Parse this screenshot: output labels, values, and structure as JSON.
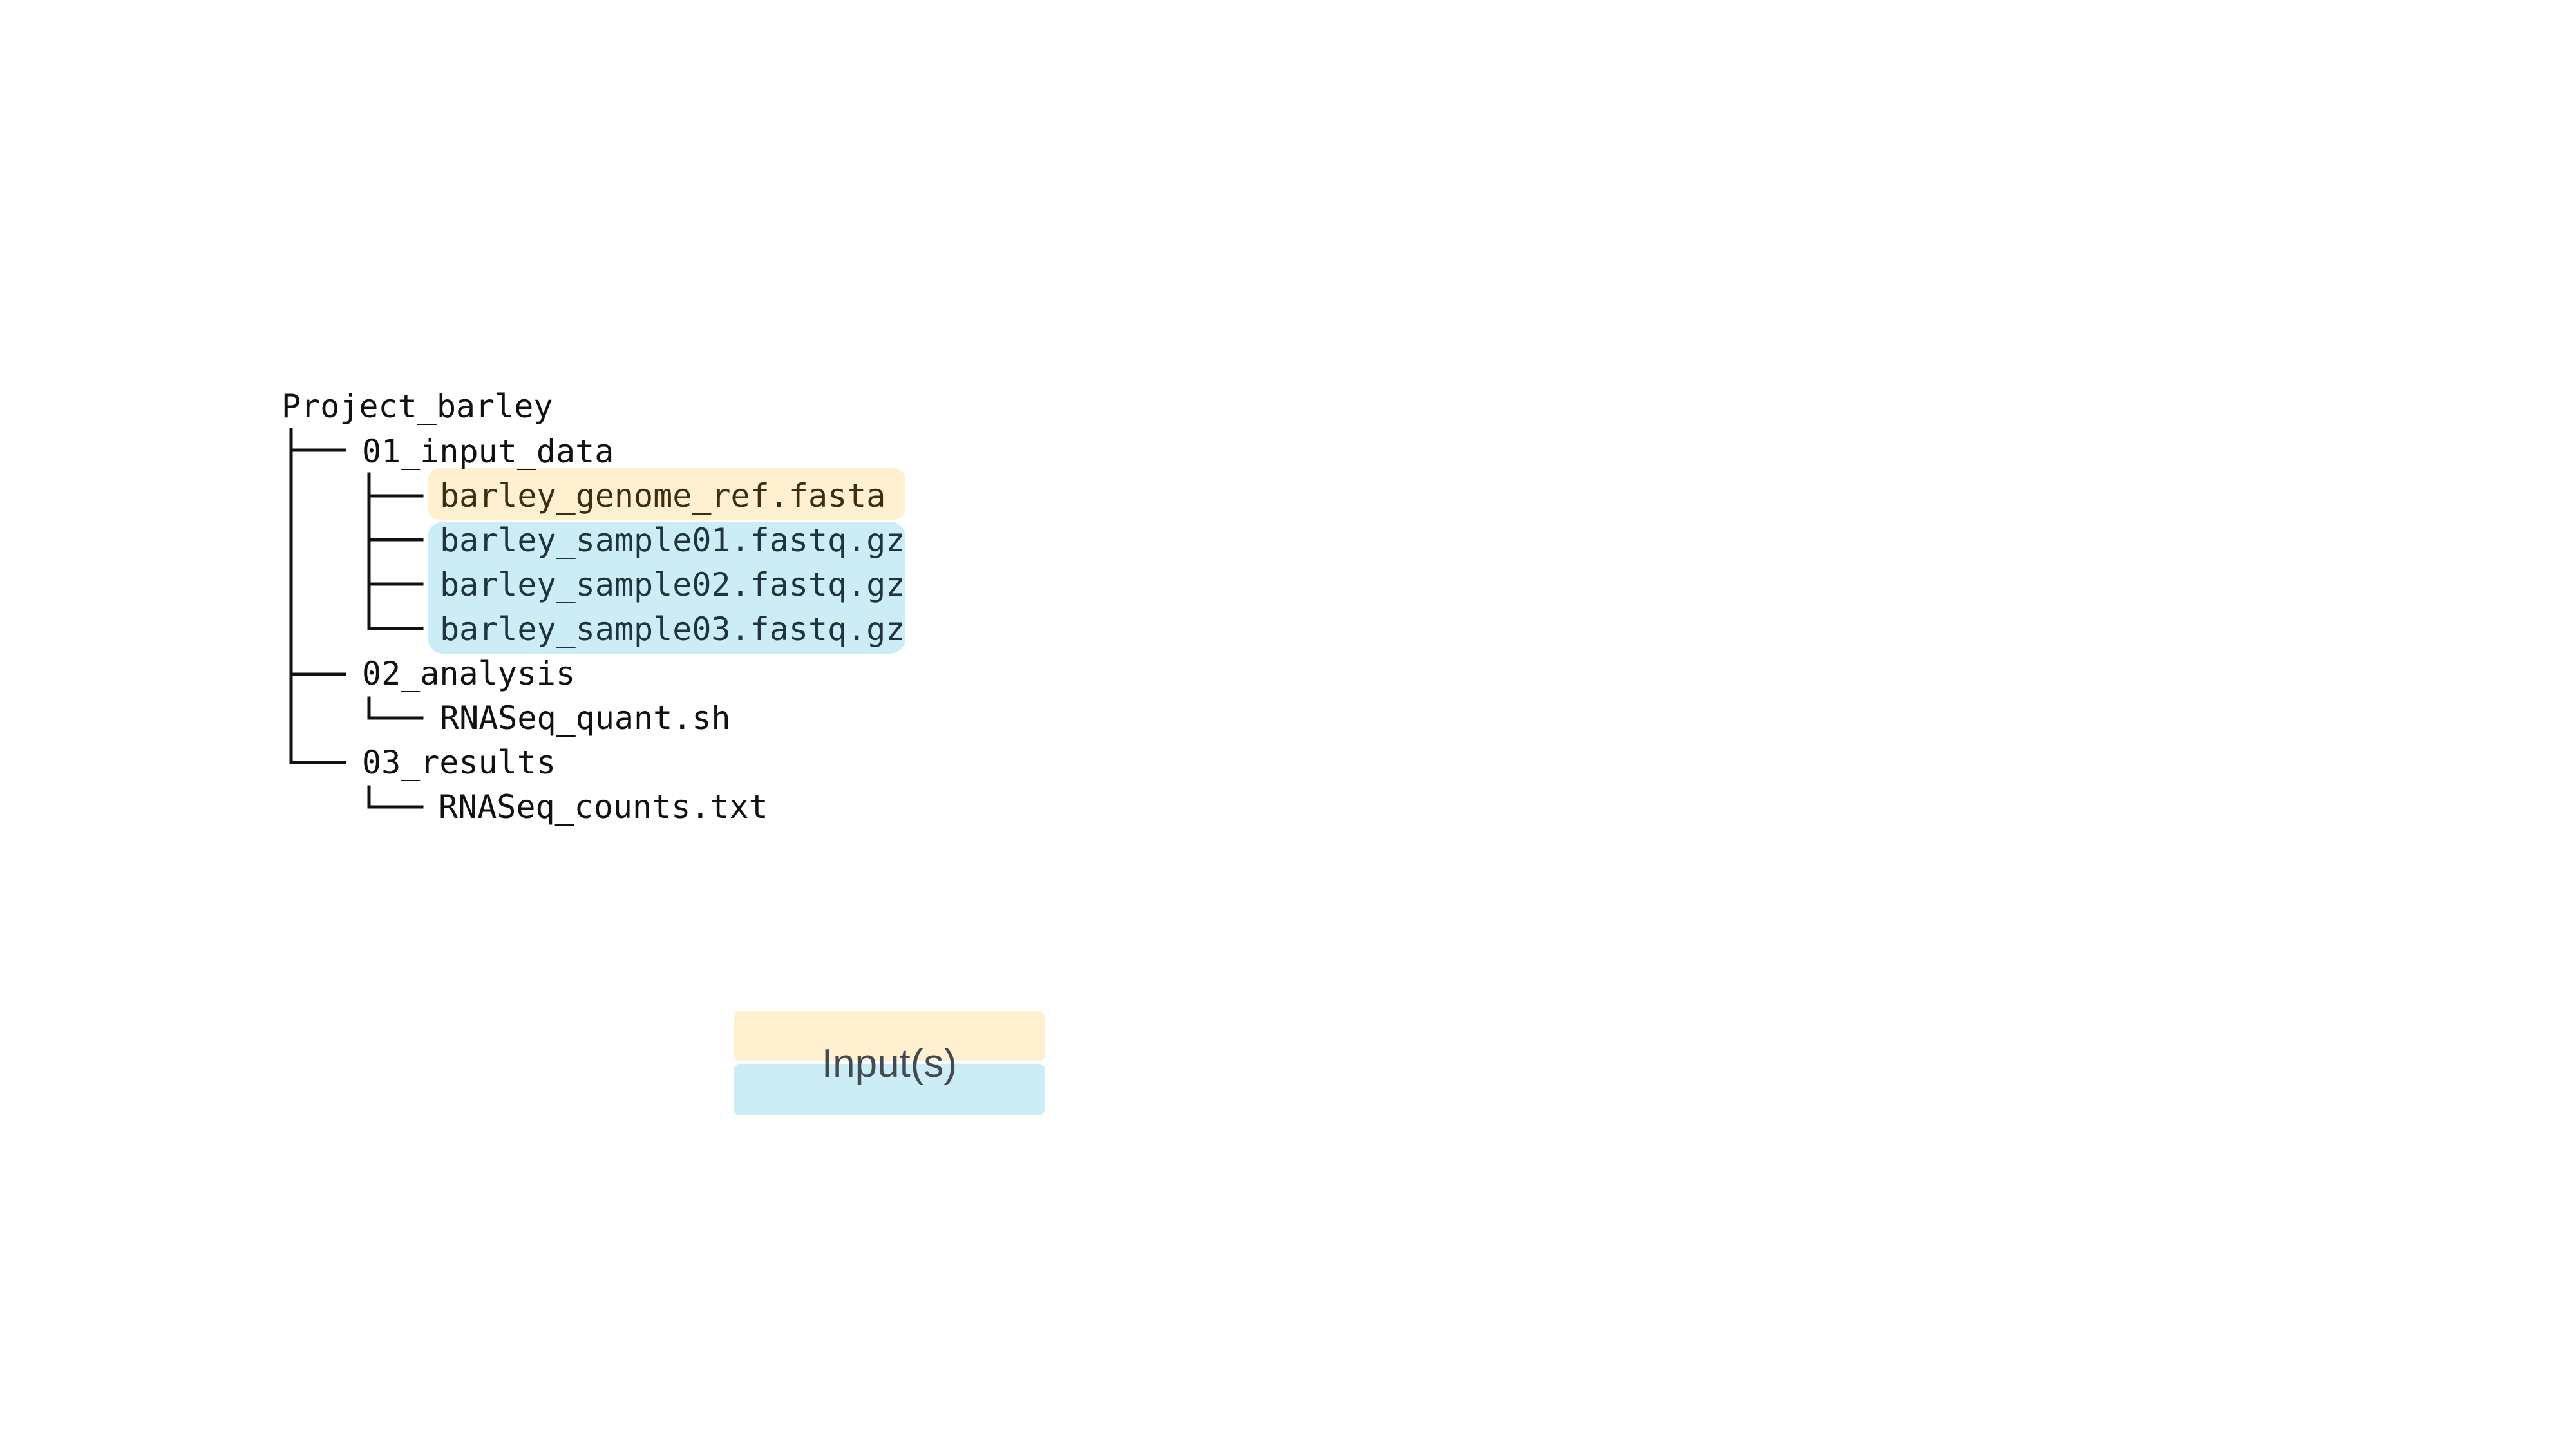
{
  "tree": {
    "root": "Project_barley",
    "folders": [
      {
        "name": "01_input_data",
        "files": [
          {
            "name": "barley_genome_ref.fasta",
            "highlight": "reference"
          },
          {
            "name": "barley_sample01.fastq.gz",
            "highlight": "sample"
          },
          {
            "name": "barley_sample02.fastq.gz",
            "highlight": "sample"
          },
          {
            "name": "barley_sample03.fastq.gz",
            "highlight": "sample"
          }
        ]
      },
      {
        "name": "02_analysis",
        "files": [
          {
            "name": "RNASeq_quant.sh",
            "highlight": null
          }
        ]
      },
      {
        "name": "03_results",
        "files": [
          {
            "name": "RNASeq_counts.txt",
            "highlight": null
          }
        ]
      }
    ]
  },
  "legend": {
    "label": "Input(s)"
  },
  "colors": {
    "reference": "#fff1cf",
    "sample": "#cdedf6",
    "line": "#111111",
    "text": "#111111"
  }
}
